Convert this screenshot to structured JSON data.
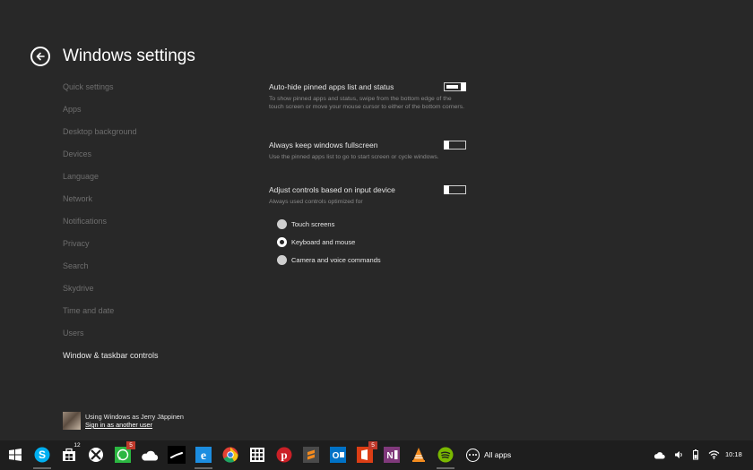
{
  "header": {
    "title": "Windows settings"
  },
  "nav": {
    "items": [
      "Quick settings",
      "Apps",
      "Desktop background",
      "Devices",
      "Language",
      "Network",
      "Notifications",
      "Privacy",
      "Search",
      "Skydrive",
      "Time and date",
      "Users",
      "Window & taskbar controls"
    ],
    "active_index": 12
  },
  "settings": [
    {
      "title": "Auto-hide pinned apps list and status",
      "description": "To show pinned apps and status, swipe from the bottom edge of the touch screen or move your mouse cursor to either of the bottom corners.",
      "toggle": "on"
    },
    {
      "title": "Always keep windows fullscreen",
      "description": "Use the pinned apps list to go to start screen or cycle windows.",
      "toggle": "off"
    },
    {
      "title": "Adjust controls based on input device",
      "description": "Always used controls optimized for",
      "toggle": "off",
      "options": [
        "Touch screens",
        "Keyboard and mouse",
        "Camera and voice commands"
      ],
      "selected_option": 1
    }
  ],
  "user": {
    "status": "Using Windows as Jerry Jäppinen",
    "link": "Sign in as another user"
  },
  "taskbar": {
    "apps": [
      {
        "name": "start-icon",
        "running": false
      },
      {
        "name": "skype-icon",
        "running": true
      },
      {
        "name": "store-icon",
        "badge": "12",
        "running": false
      },
      {
        "name": "xbox-icon",
        "running": false
      },
      {
        "name": "whatsapp-icon",
        "badge": "5",
        "running": false
      },
      {
        "name": "skydrive-icon",
        "running": false
      },
      {
        "name": "steam-icon",
        "running": false
      },
      {
        "name": "internet-explorer-icon",
        "running": true
      },
      {
        "name": "chrome-icon",
        "running": false
      },
      {
        "name": "calculator-icon",
        "running": false
      },
      {
        "name": "pinterest-icon",
        "running": false
      },
      {
        "name": "sublime-text-icon",
        "running": false
      },
      {
        "name": "outlook-icon",
        "running": false
      },
      {
        "name": "office-icon",
        "badge": "5",
        "running": false
      },
      {
        "name": "onenote-icon",
        "running": false
      },
      {
        "name": "vlc-icon",
        "running": false
      },
      {
        "name": "spotify-icon",
        "running": true
      }
    ],
    "all_apps_label": "All apps",
    "tray": [
      "cloud-icon",
      "volume-icon",
      "battery-icon",
      "wifi-icon"
    ],
    "clock": "10:18"
  },
  "colors": {
    "background": "#282828",
    "taskbar": "#1e1e1e",
    "nav_inactive": "#6e6e6e",
    "badge": "#c0392b"
  }
}
